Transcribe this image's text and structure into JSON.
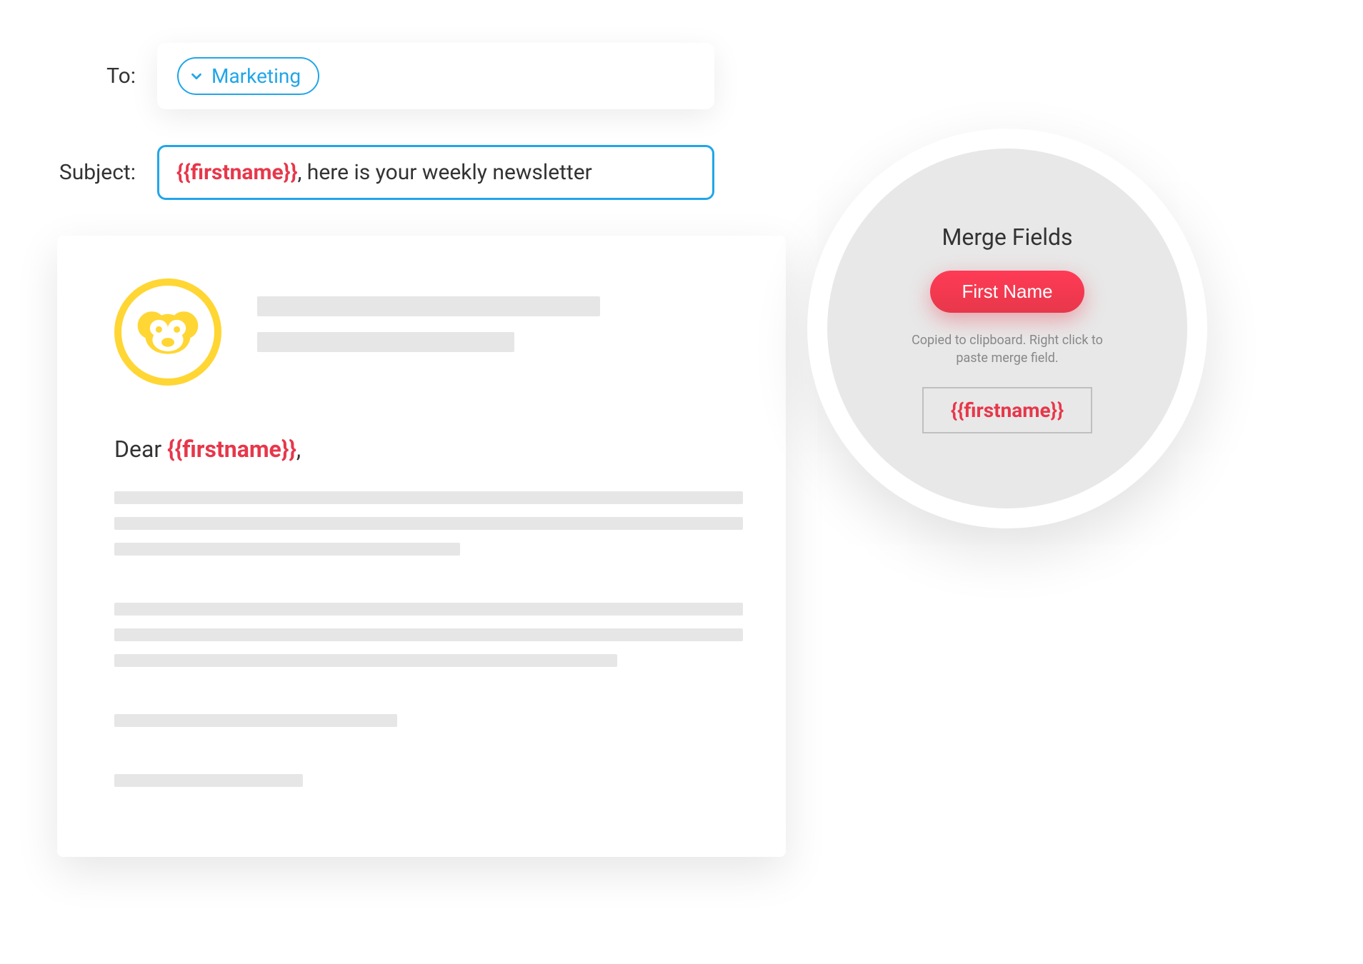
{
  "header": {
    "to_label": "To:",
    "subject_label": "Subject:",
    "recipient_chip": "Marketing"
  },
  "subject": {
    "merge_token": "{{firstname}}",
    "rest": ", here is your weekly newsletter"
  },
  "email": {
    "greeting_prefix": "Dear ",
    "greeting_token": "{{firstname}}",
    "greeting_suffix": ","
  },
  "popover": {
    "title": "Merge Fields",
    "button": "First Name",
    "hint": "Copied to clipboard. Right click to paste merge field.",
    "token": "{{firstname}}"
  },
  "colors": {
    "accent_blue": "#21a6e8",
    "accent_red": "#e7374a",
    "logo_yellow": "#ffd633",
    "skeleton": "#e6e6e6"
  }
}
